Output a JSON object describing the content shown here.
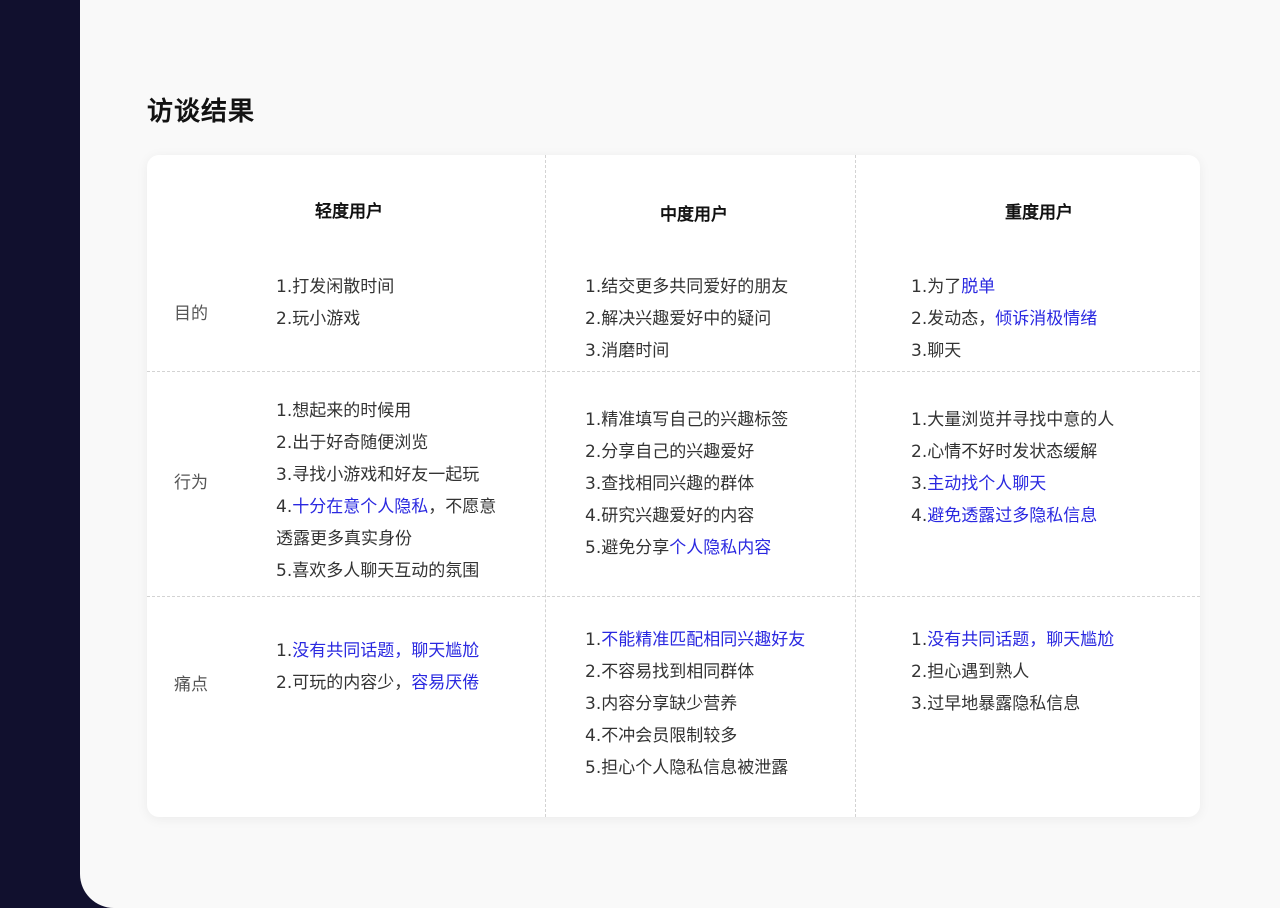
{
  "title": "访谈结果",
  "columns": [
    "轻度用户",
    "中度用户",
    "重度用户"
  ],
  "rows": [
    {
      "label": "目的",
      "cells": [
        [
          [
            {
              "t": "1.打发闲散时间"
            }
          ],
          [
            {
              "t": "2.玩小游戏"
            }
          ]
        ],
        [
          [
            {
              "t": "1.结交更多共同爱好的朋友"
            }
          ],
          [
            {
              "t": "2.解决兴趣爱好中的疑问"
            }
          ],
          [
            {
              "t": "3.消磨时间"
            }
          ]
        ],
        [
          [
            {
              "t": "1.为了"
            },
            {
              "t": "脱单",
              "hl": true
            }
          ],
          [
            {
              "t": "2.发动态，"
            },
            {
              "t": "倾诉消极情绪",
              "hl": true
            }
          ],
          [
            {
              "t": "3.聊天"
            }
          ]
        ]
      ]
    },
    {
      "label": "行为",
      "cells": [
        [
          [
            {
              "t": "1.想起来的时候用"
            }
          ],
          [
            {
              "t": "2.出于好奇随便浏览"
            }
          ],
          [
            {
              "t": "3.寻找小游戏和好友一起玩"
            }
          ],
          [
            {
              "t": "4."
            },
            {
              "t": "十分在意个人隐私",
              "hl": true
            },
            {
              "t": "，不愿意"
            }
          ],
          [
            {
              "t": "透露更多真实身份"
            }
          ],
          [
            {
              "t": "5.喜欢多人聊天互动的氛围"
            }
          ]
        ],
        [
          [
            {
              "t": "1.精准填写自己的兴趣标签"
            }
          ],
          [
            {
              "t": "2.分享自己的兴趣爱好"
            }
          ],
          [
            {
              "t": "3.查找相同兴趣的群体"
            }
          ],
          [
            {
              "t": "4.研究兴趣爱好的内容"
            }
          ],
          [
            {
              "t": "5.避免分享"
            },
            {
              "t": "个人隐私内容",
              "hl": true
            }
          ]
        ],
        [
          [
            {
              "t": "1.大量浏览并寻找中意的人"
            }
          ],
          [
            {
              "t": "2.心情不好时发状态缓解"
            }
          ],
          [
            {
              "t": "3."
            },
            {
              "t": "主动找个人聊天",
              "hl": true
            }
          ],
          [
            {
              "t": "4."
            },
            {
              "t": "避免透露过多隐私信息",
              "hl": true
            }
          ]
        ]
      ]
    },
    {
      "label": "痛点",
      "cells": [
        [
          [
            {
              "t": "1."
            },
            {
              "t": "没有共同话题，聊天尴尬",
              "hl": true
            }
          ],
          [
            {
              "t": "2.可玩的内容少，"
            },
            {
              "t": "容易厌倦",
              "hl": true
            }
          ]
        ],
        [
          [
            {
              "t": "1."
            },
            {
              "t": "不能精准匹配相同兴趣好友",
              "hl": true
            }
          ],
          [
            {
              "t": "2.不容易找到相同群体"
            }
          ],
          [
            {
              "t": "3.内容分享缺少营养"
            }
          ],
          [
            {
              "t": "4.不冲会员限制较多"
            }
          ],
          [
            {
              "t": "5.担心个人隐私信息被泄露"
            }
          ]
        ],
        [
          [
            {
              "t": "1."
            },
            {
              "t": "没有共同话题，聊天尴尬",
              "hl": true
            }
          ],
          [
            {
              "t": "2.担心遇到熟人"
            }
          ],
          [
            {
              "t": "3.过早地暴露隐私信息"
            }
          ]
        ]
      ]
    }
  ],
  "colors": {
    "highlight": "#2a28e0",
    "text": "#333333",
    "sidebar": "#11102e",
    "page_bg": "#f9f9f9"
  }
}
